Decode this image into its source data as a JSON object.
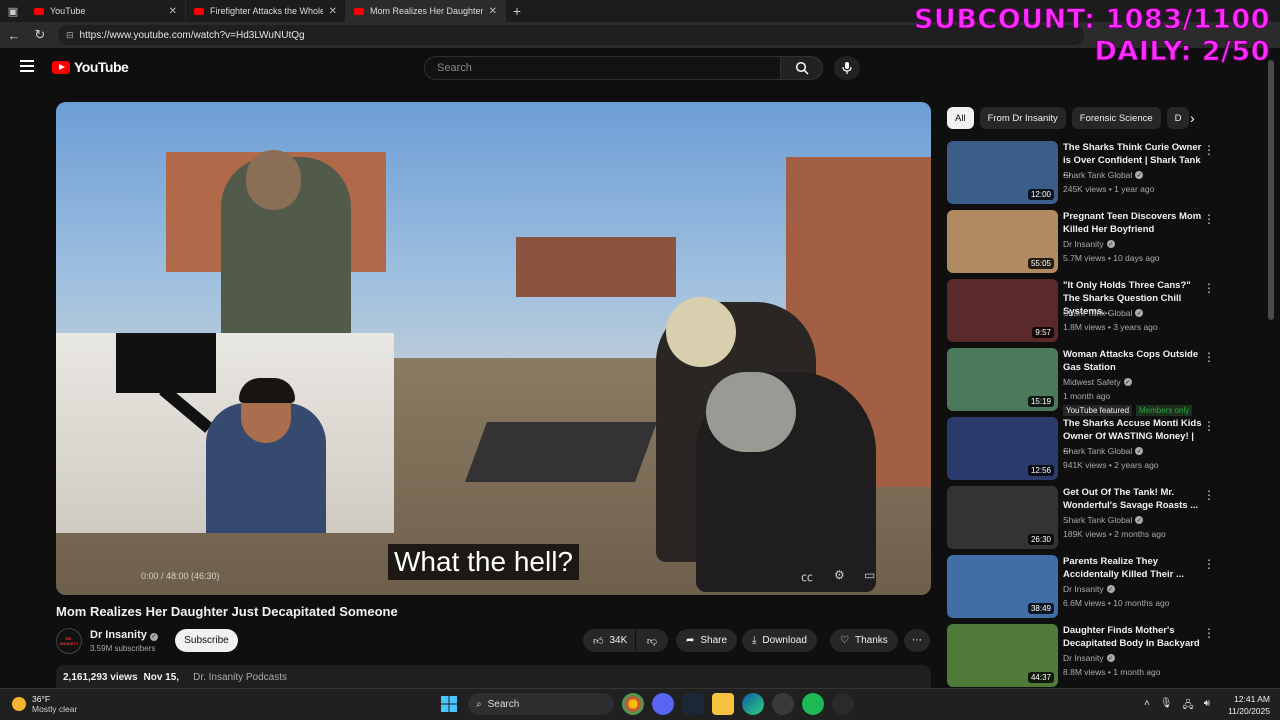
{
  "browser": {
    "tabs": [
      {
        "label": "YouTube"
      },
      {
        "label": "Firefighter Attacks the Whole Poli"
      },
      {
        "label": "Mom Realizes Her Daughter Just"
      }
    ],
    "url": "https://www.youtube.com/watch?v=Hd3LWuNUtQg"
  },
  "overlay": {
    "subcount": "SUBCOUNT: 1083/1100",
    "daily": "DAILY: 2/50"
  },
  "header": {
    "logo_text": "YouTube",
    "search_placeholder": "Search"
  },
  "player": {
    "subtitle": "What the hell?",
    "time": "0:00 / 48:00 (46:30)"
  },
  "video": {
    "title": "Mom Realizes Her Daughter Just Decapitated Someone",
    "channel": "Dr Insanity",
    "subscribers": "3.59M subscribers",
    "subscribe_label": "Subscribe",
    "likes": "34K",
    "share_label": "Share",
    "download_label": "Download",
    "thanks_label": "Thanks",
    "views": "2,161,293 views",
    "date": "Nov 15,",
    "tag": "Dr. Insanity Podcasts",
    "avatar_text": "DR. INSANITY"
  },
  "chips": [
    "All",
    "From Dr Insanity",
    "Forensic Science",
    "D"
  ],
  "recommendations": [
    {
      "title": "The Sharks Think Curie Owner is Over Confident | Shark Tank ...",
      "channel": "Shark Tank Global",
      "meta": "245K views • 1 year ago",
      "duration": "12:00",
      "thumb_color": "#3a5d8a"
    },
    {
      "title": "Pregnant Teen Discovers Mom Killed Her Boyfriend",
      "channel": "Dr Insanity",
      "meta": "5.7M views • 10 days ago",
      "duration": "55:05",
      "thumb_color": "#b08a60"
    },
    {
      "title": "\"It Only Holds Three Cans?\" The Sharks Question Chill Systems...",
      "channel": "Shark Tank Global",
      "meta": "1.8M views • 3 years ago",
      "duration": "9:57",
      "thumb_color": "#5a2a2a"
    },
    {
      "title": "Woman Attacks Cops Outside Gas Station",
      "channel": "Midwest Safety",
      "meta": "1 month ago",
      "duration": "15:19",
      "thumb_color": "#4a7a5a",
      "featured": "YouTube featured",
      "members": "Members only"
    },
    {
      "title": "The Sharks Accuse Monti Kids Owner Of WASTING Money! | ...",
      "channel": "Shark Tank Global",
      "meta": "941K views • 2 years ago",
      "duration": "12:56",
      "thumb_color": "#2a3a6a"
    },
    {
      "title": "Get Out Of The Tank! Mr. Wonderful's Savage Roasts ...",
      "channel": "Shark Tank Global",
      "meta": "189K views • 2 months ago",
      "duration": "26:30",
      "thumb_color": "#333333"
    },
    {
      "title": "Parents Realize They Accidentally Killed Their ...",
      "channel": "Dr Insanity",
      "meta": "6.6M views • 10 months ago",
      "duration": "38:49",
      "thumb_color": "#3f6fa6"
    },
    {
      "title": "Daughter Finds Mother's Decapitated Body In Backyard",
      "channel": "Dr Insanity",
      "meta": "8.8M views • 1 month ago",
      "duration": "44:37",
      "thumb_color": "#4f7a3a"
    }
  ],
  "taskbar": {
    "temp": "36°F",
    "condition": "Mostly clear",
    "search_label": "Search",
    "time": "12:41 AM",
    "date": "11/20/2025"
  }
}
